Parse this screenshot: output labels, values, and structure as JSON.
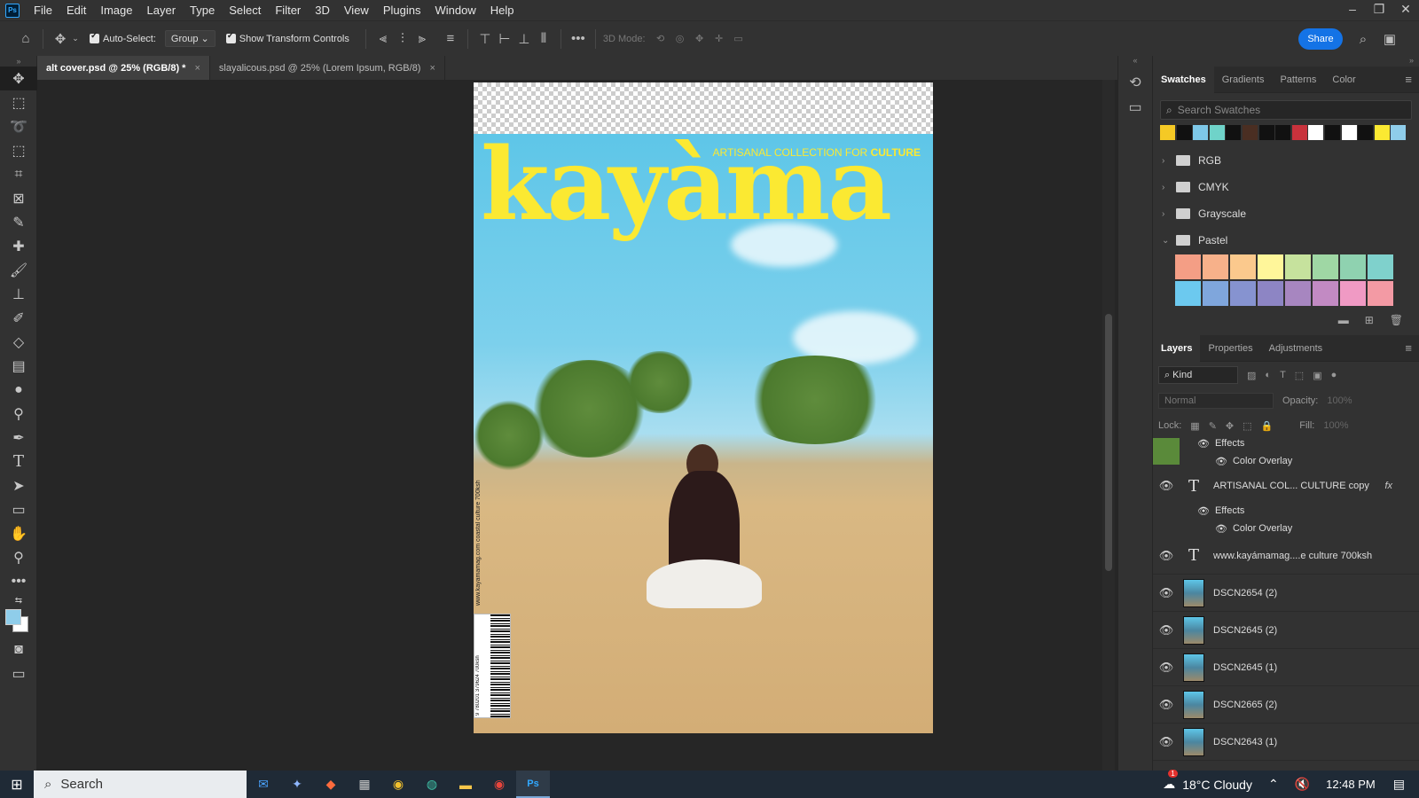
{
  "menubar": {
    "logo": "Ps",
    "items": [
      "File",
      "Edit",
      "Image",
      "Layer",
      "Type",
      "Select",
      "Filter",
      "3D",
      "View",
      "Plugins",
      "Window",
      "Help"
    ]
  },
  "options": {
    "auto_select_label": "Auto-Select:",
    "auto_select_value": "Group",
    "transform_controls_label": "Show Transform Controls",
    "mode_3d_label": "3D Mode:",
    "share_label": "Share"
  },
  "tabs": [
    {
      "label": "alt cover.psd @ 25% (RGB/8) *",
      "close": "×"
    },
    {
      "label": "slayalicous.psd @ 25% (Lorem Ipsum, RGB/8)",
      "close": "×"
    }
  ],
  "cover": {
    "masthead": "kayàma",
    "tagline_prefix": "ARTISANAL COLLECTION FOR ",
    "tagline_bold": "CULTURE",
    "spine_text": "www.kayamamag.com coastal culture 700ksh",
    "barcode_number": "9 780201 379624 700ksh"
  },
  "swatches_panel": {
    "tabs": [
      "Swatches",
      "Gradients",
      "Patterns",
      "Color"
    ],
    "search_placeholder": "Search Swatches",
    "recent": [
      "#f5c925",
      "#111111",
      "#7ec8e8",
      "#6fd3c9",
      "#111111",
      "#4a2e22",
      "#111111",
      "#111111",
      "#c8323c",
      "#ffffff",
      "#111111",
      "#ffffff",
      "#111111",
      "#fbe932",
      "#8fcdea"
    ],
    "groups": [
      "RGB",
      "CMYK",
      "Grayscale",
      "Pastel"
    ],
    "pastel_colors": [
      "#f49e85",
      "#f7b18a",
      "#fbc98d",
      "#fff69a",
      "#c6e29d",
      "#9fd7a4",
      "#8fd2b0",
      "#7fd1cc",
      "#6cc9ef",
      "#7fa6dc",
      "#8693d0",
      "#8d85c4",
      "#a786c0",
      "#c28ac3",
      "#f09ac4",
      "#f39aa4"
    ]
  },
  "layers_panel": {
    "tabs": [
      "Layers",
      "Properties",
      "Adjustments"
    ],
    "kind_label": "Kind",
    "blend_mode": "Normal",
    "opacity_label": "Opacity:",
    "opacity_value": "100%",
    "lock_label": "Lock:",
    "fill_label": "Fill:",
    "fill_value": "100%",
    "effects_label": "Effects",
    "color_overlay_label": "Color Overlay",
    "text_layers": [
      "ARTISANAL COL... CULTURE copy",
      "www.kayámamag....e culture 700ksh"
    ],
    "fx_label": "fx",
    "image_layers": [
      "DSCN2654 (2)",
      "DSCN2645 (2)",
      "DSCN2645 (1)",
      "DSCN2665 (2)",
      "DSCN2643 (1)"
    ]
  },
  "taskbar": {
    "search_label": "Search",
    "weather": "18°C Cloudy",
    "time": "12:48 PM",
    "notification_count": "1"
  }
}
